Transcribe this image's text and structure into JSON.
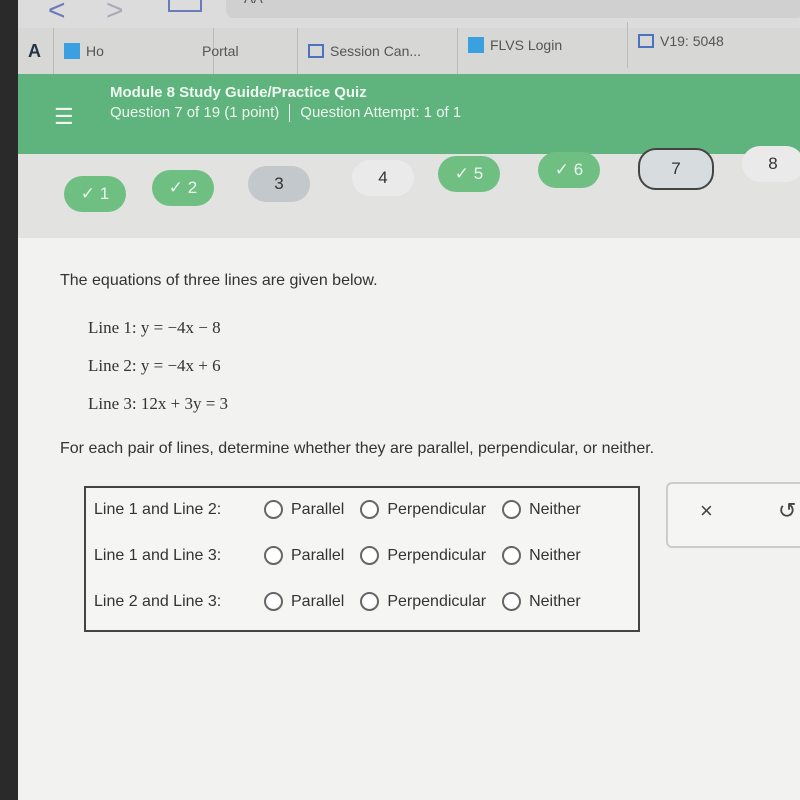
{
  "browser": {
    "back": "<",
    "forward": ">",
    "address": "AA",
    "tabs": [
      {
        "label": "A"
      },
      {
        "label": "Ho"
      },
      {
        "label": "Portal"
      },
      {
        "label": "Session Can..."
      },
      {
        "label": "FLVS Login"
      },
      {
        "label": "V19: 5048"
      }
    ]
  },
  "header": {
    "title": "Module 8 Study Guide/Practice Quiz",
    "question": "Question 7 of 19 (1 point)",
    "attempt": "Question Attempt: 1 of 1",
    "menu_icon": "hamburger-icon",
    "color": "#5fb37d"
  },
  "question_nav": [
    {
      "label": "✓ 1",
      "state": "answered"
    },
    {
      "label": "✓ 2",
      "state": "answered"
    },
    {
      "label": "3",
      "state": "visited"
    },
    {
      "label": "4",
      "state": "unanswered"
    },
    {
      "label": "✓ 5",
      "state": "answered"
    },
    {
      "label": "✓ 6",
      "state": "answered"
    },
    {
      "label": "7",
      "state": "current"
    },
    {
      "label": "8",
      "state": "unanswered"
    }
  ],
  "question": {
    "intro": "The equations of three lines are given below.",
    "lines": [
      "Line 1: y = −4x − 8",
      "Line 2: y = −4x + 6",
      "Line 3: 12x + 3y = 3"
    ],
    "prompt": "For each pair of lines, determine whether they are parallel, perpendicular, or neither.",
    "rows": [
      {
        "label": "Line 1 and Line 2:",
        "options": [
          "Parallel",
          "Perpendicular",
          "Neither"
        ]
      },
      {
        "label": "Line 1 and Line 3:",
        "options": [
          "Parallel",
          "Perpendicular",
          "Neither"
        ]
      },
      {
        "label": "Line 2 and Line 3:",
        "options": [
          "Parallel",
          "Perpendicular",
          "Neither"
        ]
      }
    ]
  },
  "tools": {
    "clear": "×",
    "undo": "↺"
  }
}
